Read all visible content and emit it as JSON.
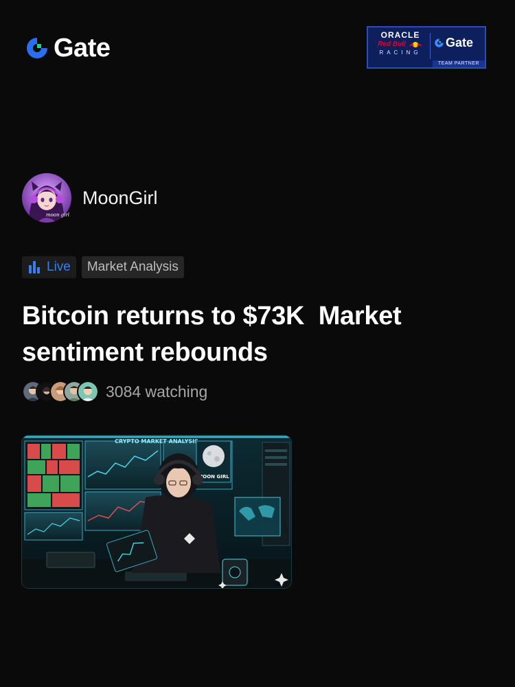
{
  "header": {
    "brand": "Gate",
    "brand_icon": "gate-logo-icon",
    "partner": {
      "line1": "ORACLE",
      "line2": "Red Bull",
      "line3": "RACING",
      "brand": "Gate",
      "strip": "TEAM PARTNER"
    }
  },
  "author": {
    "name": "MoonGirl",
    "avatar_text": "moon girl",
    "avatar_icon": "anime-girl-avatar"
  },
  "tags": {
    "live_label": "Live",
    "live_icon": "live-bars-icon",
    "category": "Market Analysis"
  },
  "post": {
    "title": "Bitcoin returns to $73K  Market sentiment rebounds"
  },
  "watchers": {
    "count_text": "3084 watching",
    "avatars": [
      "watcher-1",
      "watcher-2",
      "watcher-3",
      "watcher-4",
      "watcher-5"
    ]
  },
  "thumbnail": {
    "heading": "CRYPTO MARKET ANALYSIS",
    "badge": "MOON GIRL"
  },
  "colors": {
    "background": "#0a0a0a",
    "accent_blue": "#3a7ff0",
    "gate_blue": "#2a6ff2",
    "gate_green": "#1cd28e",
    "tag_bg": "#262626",
    "muted_text": "#a8a8a8"
  }
}
